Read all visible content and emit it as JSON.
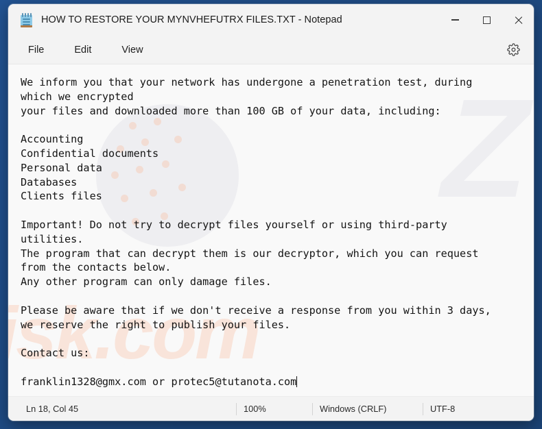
{
  "window": {
    "title": "HOW TO RESTORE YOUR MYNVHEFUTRX FILES.TXT - Notepad",
    "app_icon": "notepad-icon",
    "controls": {
      "minimize": "minimize-icon",
      "maximize": "maximize-icon",
      "close": "close-icon"
    }
  },
  "menu": {
    "file": "File",
    "edit": "Edit",
    "view": "View",
    "settings_icon": "gear-icon"
  },
  "document": {
    "body": "We inform you that your network has undergone a penetration test, during\nwhich we encrypted\nyour files and downloaded more than 100 GB of your data, including:\n\nAccounting\nConfidential documents\nPersonal data\nDatabases\nClients files\n\nImportant! Do not try to decrypt files yourself or using third-party\nutilities.\nThe program that can decrypt them is our decryptor, which you can request\nfrom the contacts below.\nAny other program can only damage files.\n\nPlease be aware that if we don't receive a response from you within 3 days,\nwe reserve the right to publish your files.\n\nContact us:\n\nfranklin1328@gmx.com or protec5@tutanota.com",
    "lines": [
      "We inform you that your network has undergone a penetration test, during",
      "which we encrypted",
      "your files and downloaded more than 100 GB of your data, including:",
      "",
      "Accounting",
      "Confidential documents",
      "Personal data",
      "Databases",
      "Clients files",
      "",
      "Important! Do not try to decrypt files yourself or using third-party",
      "utilities.",
      "The program that can decrypt them is our decryptor, which you can request",
      "from the contacts below.",
      "Any other program can only damage files.",
      "",
      "Please be aware that if we don't receive a response from you within 3 days,",
      "we reserve the right to publish your files.",
      "",
      "Contact us:",
      "",
      "franklin1328@gmx.com or protec5@tutanota.com"
    ],
    "contacts": [
      "franklin1328@gmx.com",
      "protec5@tutanota.com"
    ]
  },
  "watermark": {
    "text": "isk.com",
    "mark": "Z"
  },
  "status_bar": {
    "position": "Ln 18, Col 45",
    "zoom": "100%",
    "line_endings": "Windows (CRLF)",
    "encoding": "UTF-8"
  },
  "colors": {
    "desktop": "#20508C",
    "window_chrome": "#f3f3f3",
    "editor_background": "#f9f9f9",
    "text": "#141414",
    "icon_blue": "#8ecbe8"
  }
}
